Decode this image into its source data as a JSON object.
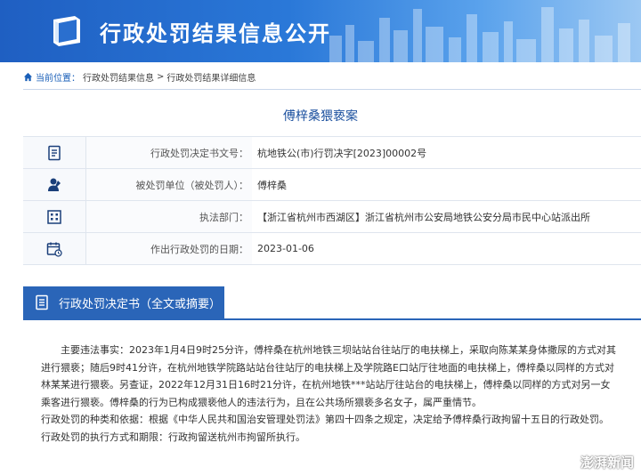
{
  "header": {
    "title": "行政处罚结果信息公开",
    "book_icon": "book-icon",
    "brand_color": "#2a78d8"
  },
  "breadcrumb": {
    "here_label": "当前位置：",
    "level1": "行政处罚结果信息",
    "separator1": ">",
    "level2": "行政处罚结果详细信息",
    "icon": "home-icon"
  },
  "case": {
    "title": "傅梓桑猥亵案"
  },
  "info_rows": [
    {
      "icon": "document-number-icon",
      "label": "行政处罚决定书文号：",
      "value": "杭地铁公(市)行罚决字[2023]00002号"
    },
    {
      "icon": "person-icon",
      "label": "被处罚单位（被处罚人）：",
      "value": "傅梓桑"
    },
    {
      "icon": "building-icon",
      "label": "执法部门：",
      "value": "【浙江省杭州市西湖区】浙江省杭州市公安局地铁公安分局市民中心站派出所"
    },
    {
      "icon": "calendar-icon",
      "label": "作出行政处罚的日期：",
      "value": "2023-01-06"
    }
  ],
  "decision": {
    "tab_label": "行政处罚决定书（全文或摘要）",
    "tab_icon": "document-icon",
    "paragraph1": "主要违法事实：2023年1月4日9时25分许，傅梓桑在杭州地铁三坝站站台往站厅的电扶梯上，采取向陈某某身体撒尿的方式对其进行猥亵；随后9时41分许，在杭州地铁学院路站站台往站厅的电扶梯上及学院路E口站厅往地面的电扶梯上，傅梓桑以同样的方式对林某某进行猥亵。另查证，2022年12月31日16时21分许，在杭州地铁***站站厅往站台的电扶梯上，傅梓桑以同样的方式对另一女乘客进行猥亵。傅梓桑的行为已构成猥亵他人的违法行为，且在公共场所猥亵多名女子，属严重情节。",
    "paragraph2": "行政处罚的种类和依据：根据《中华人民共和国治安管理处罚法》第四十四条之规定，决定给予傅梓桑行政拘留十五日的行政处罚。",
    "paragraph3": "行政处罚的执行方式和期限：行政拘留送杭州市拘留所执行。"
  },
  "watermark": {
    "text": "澎湃新闻",
    "icon": "weibo-icon"
  }
}
